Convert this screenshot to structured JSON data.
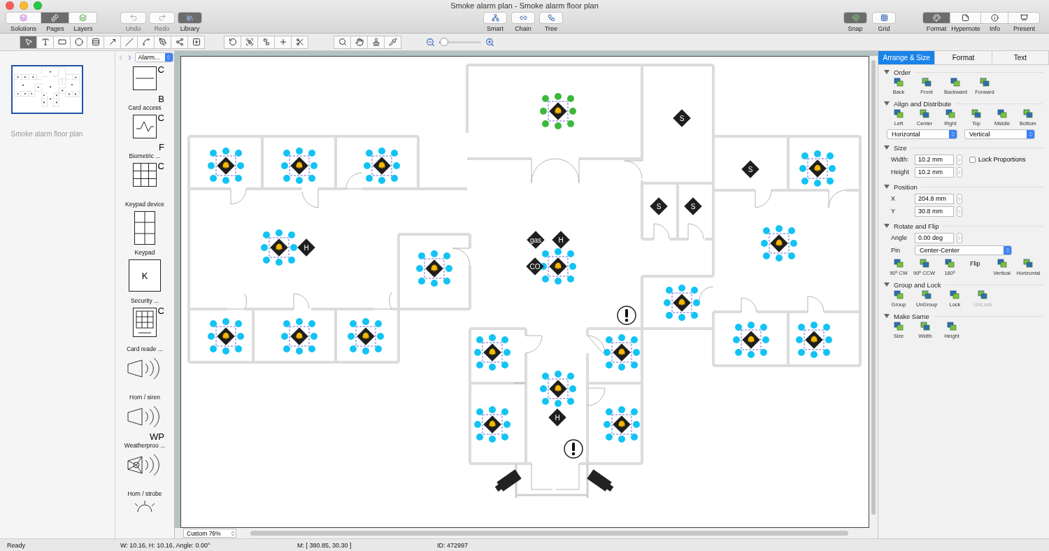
{
  "window": {
    "title": "Smoke alarm plan - Smoke alarm floor plan"
  },
  "view_modes": [
    {
      "label": "Solutions",
      "selected": false
    },
    {
      "label": "Pages",
      "selected": true
    },
    {
      "label": "Layers",
      "selected": false
    }
  ],
  "history": [
    {
      "label": "Undo",
      "disabled": true
    },
    {
      "label": "Redo",
      "disabled": true
    }
  ],
  "library_button": {
    "label": "Library",
    "selected": true
  },
  "diagram_tools": [
    {
      "label": "Smart",
      "kind": "smart"
    },
    {
      "label": "Chain",
      "kind": "chain"
    },
    {
      "label": "Tree",
      "kind": "tree"
    }
  ],
  "view_toggles": [
    {
      "label": "Snap",
      "selected": true,
      "kind": "snap"
    },
    {
      "label": "Grid",
      "selected": false,
      "kind": "grid"
    }
  ],
  "panel_toggles": [
    {
      "label": "Format",
      "selected": true,
      "kind": "format"
    },
    {
      "label": "Hypernote",
      "selected": false,
      "kind": "hypernote"
    },
    {
      "label": "Info",
      "selected": false,
      "kind": "info"
    },
    {
      "label": "Present",
      "selected": false,
      "kind": "present"
    }
  ],
  "drawing_tools": [
    {
      "kind": "pointer",
      "selected": true
    },
    {
      "kind": "text",
      "selected": false
    },
    {
      "kind": "rect",
      "selected": false
    },
    {
      "kind": "ellipse",
      "selected": false
    },
    {
      "kind": "list",
      "selected": false
    },
    {
      "kind": "arrow",
      "selected": false
    },
    {
      "kind": "line",
      "selected": false
    },
    {
      "kind": "arc",
      "selected": false
    },
    {
      "kind": "pen",
      "selected": false
    },
    {
      "kind": "bezier",
      "selected": false
    },
    {
      "kind": "shape",
      "selected": false
    }
  ],
  "zoom_slider": {
    "level": 0.12
  },
  "pages": [
    {
      "title": "Smoke alarm floor plan",
      "selected": true
    }
  ],
  "library": {
    "dropdown": "Alarm...",
    "items": [
      {
        "kind": "card-access",
        "label": "Card access",
        "mark_top": "C",
        "mark_bottom": "B"
      },
      {
        "kind": "biometric",
        "label": "Biometric ...",
        "mark_top": "C",
        "mark_bottom": "F"
      },
      {
        "kind": "keypad-device",
        "label": "Keypad device",
        "mark_top": "C"
      },
      {
        "kind": "keypad",
        "label": "Keypad"
      },
      {
        "kind": "security",
        "label": "Security  ...",
        "mark_center": "K"
      },
      {
        "kind": "card-reader",
        "label": "Card reade ...",
        "mark_top": "C"
      },
      {
        "kind": "horn",
        "label": "Horn / siren"
      },
      {
        "kind": "horn",
        "label": "Weatherproo ...",
        "mark_bottom": "WP"
      },
      {
        "kind": "horn-strobe",
        "label": "Horn / strobe"
      },
      {
        "kind": "strobe"
      }
    ]
  },
  "canvas": {
    "devices": [
      {
        "selected": true,
        "primary": true
      },
      {
        "selected": true,
        "primary": false
      },
      {
        "selected": true,
        "primary": false
      },
      {
        "selected": true,
        "primary": false
      },
      {
        "selected": true,
        "primary": false
      },
      {
        "selected": true,
        "primary": false
      },
      {
        "selected": true,
        "primary": false
      },
      {
        "selected": true,
        "primary": false
      },
      {
        "selected": true,
        "primary": false
      },
      {
        "selected": true,
        "primary": false
      },
      {
        "selected": true,
        "primary": false
      },
      {
        "selected": true,
        "primary": false
      },
      {
        "selected": true,
        "primary": false
      },
      {
        "selected": true,
        "primary": false
      },
      {
        "selected": true,
        "primary": false
      },
      {
        "selected": true,
        "primary": false
      },
      {
        "selected": true,
        "primary": false
      },
      {
        "selected": true,
        "primary": false
      },
      {
        "selected": true,
        "primary": false
      },
      {
        "selected": true,
        "primary": false
      }
    ],
    "sensors": [
      {
        "label": "S"
      },
      {
        "label": "S"
      },
      {
        "label": "S"
      },
      {
        "label": "S"
      },
      {
        "label": "H"
      },
      {
        "label": "H"
      },
      {
        "label": "H"
      },
      {
        "label": "gas"
      },
      {
        "label": "CO"
      }
    ],
    "zoom_select": "Custom 76%"
  },
  "inspector": {
    "tabs": [
      {
        "label": "Arrange & Size",
        "selected": true
      },
      {
        "label": "Format",
        "selected": false
      },
      {
        "label": "Text",
        "selected": false
      }
    ],
    "order": {
      "title": "Order",
      "buttons": [
        "Back",
        "Front",
        "Backward",
        "Forward"
      ]
    },
    "align": {
      "title": "Align and Distribute",
      "buttons": [
        "Left",
        "Center",
        "Right",
        "Top",
        "Middle",
        "Bottom"
      ],
      "distribute": [
        "Horizontal",
        "Vertical"
      ]
    },
    "size": {
      "title": "Size",
      "width_label": "Width:",
      "width": "10.2 mm",
      "height_label": "Height",
      "height": "10.2 mm",
      "lock": {
        "label": "Lock Proportions",
        "checked": false
      }
    },
    "position": {
      "title": "Position",
      "x_label": "X",
      "x": "204.8 mm",
      "y_label": "Y",
      "y": "30.8 mm"
    },
    "rotate": {
      "title": "Rotate and Flip",
      "angle_label": "Angle",
      "angle": "0.00 deg",
      "pin_label": "Pin",
      "pin": "Center-Center",
      "rotate_buttons": [
        "90º CW",
        "90º CCW",
        "180º"
      ],
      "flip_label": "Flip",
      "flip_buttons": [
        "Vertical",
        "Horizontal"
      ]
    },
    "group": {
      "title": "Group and Lock",
      "buttons": [
        {
          "label": "Group",
          "disabled": false
        },
        {
          "label": "UnGroup",
          "disabled": false
        },
        {
          "label": "Lock",
          "disabled": false
        },
        {
          "label": "UnLock",
          "disabled": true
        }
      ]
    },
    "make_same": {
      "title": "Make Same",
      "buttons": [
        "Size",
        "Width",
        "Height"
      ]
    }
  },
  "status_bar": {
    "state": "Ready",
    "dimensions": "W: 10.16,  H: 10.16,  Angle: 0.00°",
    "mouse": "M: [ 380.85, 30.30 ]",
    "id": "ID: 472997"
  }
}
